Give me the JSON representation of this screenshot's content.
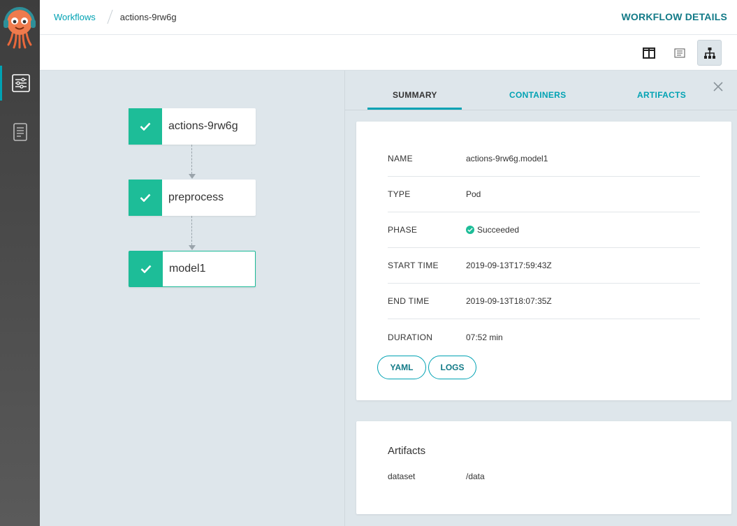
{
  "breadcrumb": {
    "parent": "Workflows",
    "current": "actions-9rw6g"
  },
  "page": {
    "title": "WORKFLOW DETAILS"
  },
  "nodes": [
    {
      "label": "actions-9rw6g",
      "status": "succeeded"
    },
    {
      "label": "preprocess",
      "status": "succeeded"
    },
    {
      "label": "model1",
      "status": "succeeded"
    }
  ],
  "tabs": [
    {
      "label": "SUMMARY"
    },
    {
      "label": "CONTAINERS"
    },
    {
      "label": "ARTIFACTS"
    }
  ],
  "summary": {
    "rows": [
      {
        "key": "NAME",
        "value": "actions-9rw6g.model1"
      },
      {
        "key": "TYPE",
        "value": "Pod"
      },
      {
        "key": "PHASE",
        "value": "Succeeded"
      },
      {
        "key": "START TIME",
        "value": "2019-09-13T17:59:43Z"
      },
      {
        "key": "END TIME",
        "value": "2019-09-13T18:07:35Z"
      },
      {
        "key": "DURATION",
        "value": "07:52 min"
      }
    ],
    "yaml_label": "YAML",
    "logs_label": "LOGS"
  },
  "artifacts": {
    "title": "Artifacts",
    "items": [
      {
        "name": "dataset",
        "path": "/data"
      }
    ]
  },
  "colors": {
    "accent": "#00a2b3",
    "success": "#1dbd98",
    "title": "#127a87"
  },
  "icons": {
    "sidebar": [
      "workflows-icon",
      "docs-icon"
    ],
    "toolbar": [
      "split-view-icon",
      "list-view-icon",
      "tree-view-icon"
    ]
  }
}
